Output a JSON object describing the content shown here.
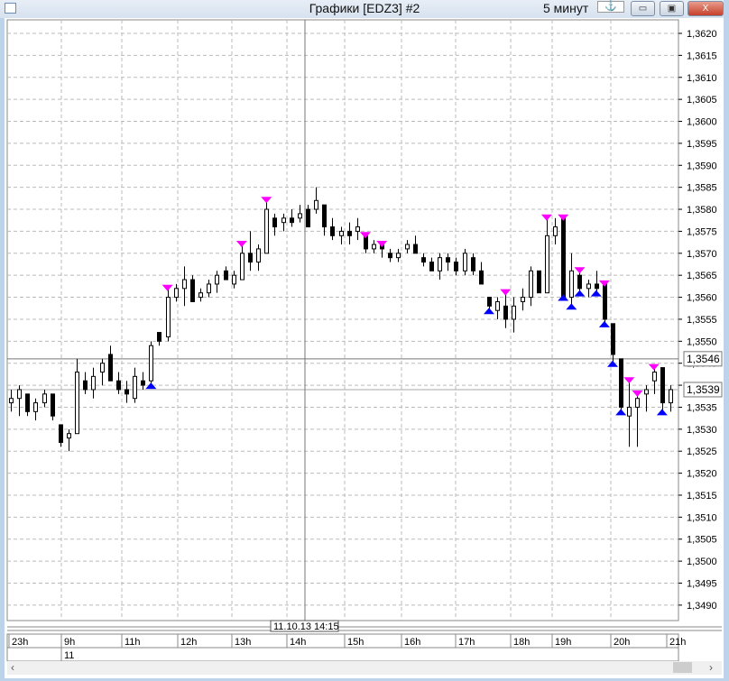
{
  "window": {
    "title": "Графики [EDZ3] #2",
    "timeframe": "5 минут",
    "anchor_icon": "anchor-icon",
    "minimize": "▭",
    "maximize": "▣",
    "close": "X"
  },
  "colors": {
    "sell": "#ff00ff",
    "buy": "#0000ff",
    "up": "#ffffff",
    "down": "#000000",
    "grid": "#bbbbbb"
  },
  "chart_data": {
    "type": "candlestick",
    "title": "Графики [EDZ3] #2",
    "ylim": [
      1.3486,
      1.3625
    ],
    "yticks": [
      "1,3620",
      "1,3615",
      "1,3610",
      "1,3605",
      "1,3600",
      "1,3595",
      "1,3590",
      "1,3585",
      "1,3580",
      "1,3575",
      "1,3570",
      "1,3565",
      "1,3560",
      "1,3555",
      "1,3550",
      "1,3545",
      "1,3540",
      "1,3535",
      "1,3530",
      "1,3525",
      "1,3520",
      "1,3515",
      "1,3510",
      "1,3505",
      "1,3500",
      "1,3495",
      "1,3490"
    ],
    "xticks": [
      "23h",
      "9h",
      "11h",
      "12h",
      "13h",
      "14h",
      "15h",
      "16h",
      "17h",
      "18h",
      "19h",
      "20h",
      "21h"
    ],
    "date_label": "11",
    "crosshair": {
      "time": "11.10.13 14:15",
      "price": "1,3546",
      "price_value": 1.3546
    },
    "last_price": {
      "label": "1,3539",
      "value": 1.3539
    },
    "candles": [
      [
        1.3536,
        1.3539,
        1.3534,
        1.3537
      ],
      [
        1.3537,
        1.354,
        1.3533,
        1.3539
      ],
      [
        1.3538,
        1.3538,
        1.3533,
        1.3534
      ],
      [
        1.3534,
        1.3537,
        1.3532,
        1.3536
      ],
      [
        1.3536,
        1.3539,
        1.3535,
        1.3538
      ],
      [
        1.3538,
        1.3538,
        1.3532,
        1.3533
      ],
      [
        1.3531,
        1.3531,
        1.3526,
        1.3527
      ],
      [
        1.3528,
        1.353,
        1.3525,
        1.3529
      ],
      [
        1.3529,
        1.3546,
        1.3529,
        1.3543
      ],
      [
        1.3541,
        1.3543,
        1.3538,
        1.3539
      ],
      [
        1.3539,
        1.3544,
        1.3537,
        1.3542
      ],
      [
        1.3543,
        1.3546,
        1.354,
        1.3545
      ],
      [
        1.3547,
        1.3549,
        1.3541,
        1.3541
      ],
      [
        1.3541,
        1.3543,
        1.3538,
        1.3539
      ],
      [
        1.3539,
        1.3541,
        1.3536,
        1.3538
      ],
      [
        1.3537,
        1.3544,
        1.3536,
        1.3542
      ],
      [
        1.3541,
        1.3543,
        1.3539,
        1.354
      ],
      [
        1.3541,
        1.355,
        1.354,
        1.3549
      ],
      [
        1.3552,
        1.3552,
        1.3549,
        1.355
      ],
      [
        1.3551,
        1.3562,
        1.355,
        1.356
      ],
      [
        1.356,
        1.3563,
        1.3559,
        1.3562
      ],
      [
        1.3562,
        1.3567,
        1.3558,
        1.3564
      ],
      [
        1.3564,
        1.3565,
        1.3559,
        1.3559
      ],
      [
        1.356,
        1.3562,
        1.3559,
        1.3561
      ],
      [
        1.3561,
        1.3564,
        1.356,
        1.3563
      ],
      [
        1.3563,
        1.3566,
        1.3561,
        1.3565
      ],
      [
        1.3566,
        1.3567,
        1.3564,
        1.3564
      ],
      [
        1.3563,
        1.3566,
        1.3562,
        1.3565
      ],
      [
        1.3564,
        1.3572,
        1.3564,
        1.357
      ],
      [
        1.357,
        1.3575,
        1.3566,
        1.3568
      ],
      [
        1.3568,
        1.3572,
        1.3566,
        1.3571
      ],
      [
        1.357,
        1.3582,
        1.357,
        1.358
      ],
      [
        1.3578,
        1.3579,
        1.3574,
        1.3576
      ],
      [
        1.3577,
        1.3579,
        1.3575,
        1.3578
      ],
      [
        1.3578,
        1.358,
        1.3576,
        1.3577
      ],
      [
        1.3578,
        1.3581,
        1.3577,
        1.3579
      ],
      [
        1.358,
        1.3581,
        1.3576,
        1.3576
      ],
      [
        1.358,
        1.3585,
        1.3579,
        1.3582
      ],
      [
        1.3581,
        1.3581,
        1.3574,
        1.3576
      ],
      [
        1.3576,
        1.3578,
        1.3573,
        1.3574
      ],
      [
        1.3574,
        1.3576,
        1.3572,
        1.3575
      ],
      [
        1.3575,
        1.3577,
        1.3572,
        1.3574
      ],
      [
        1.3575,
        1.3578,
        1.3573,
        1.3576
      ],
      [
        1.3574,
        1.3574,
        1.357,
        1.3571
      ],
      [
        1.3571,
        1.3573,
        1.357,
        1.3572
      ],
      [
        1.3572,
        1.3572,
        1.3569,
        1.3571
      ],
      [
        1.357,
        1.3571,
        1.3568,
        1.3569
      ],
      [
        1.3569,
        1.3571,
        1.3568,
        1.357
      ],
      [
        1.3571,
        1.3573,
        1.357,
        1.3572
      ],
      [
        1.3572,
        1.3574,
        1.357,
        1.357
      ],
      [
        1.3569,
        1.357,
        1.3567,
        1.3568
      ],
      [
        1.3568,
        1.3569,
        1.3566,
        1.3566
      ],
      [
        1.3566,
        1.357,
        1.3564,
        1.3569
      ],
      [
        1.3569,
        1.357,
        1.3566,
        1.3568
      ],
      [
        1.3568,
        1.3569,
        1.3565,
        1.3566
      ],
      [
        1.3566,
        1.3571,
        1.3565,
        1.357
      ],
      [
        1.3569,
        1.357,
        1.3565,
        1.3566
      ],
      [
        1.3566,
        1.3568,
        1.3563,
        1.3563
      ],
      [
        1.356,
        1.356,
        1.3557,
        1.3558
      ],
      [
        1.3557,
        1.356,
        1.3555,
        1.3559
      ],
      [
        1.3558,
        1.3561,
        1.3553,
        1.3555
      ],
      [
        1.3555,
        1.356,
        1.3552,
        1.3558
      ],
      [
        1.3559,
        1.3562,
        1.3557,
        1.356
      ],
      [
        1.356,
        1.3567,
        1.3558,
        1.3566
      ],
      [
        1.3566,
        1.3566,
        1.3561,
        1.3561
      ],
      [
        1.3561,
        1.3578,
        1.3561,
        1.3574
      ],
      [
        1.3574,
        1.3578,
        1.3572,
        1.3576
      ],
      [
        1.3578,
        1.3578,
        1.356,
        1.356
      ],
      [
        1.356,
        1.357,
        1.3558,
        1.3566
      ],
      [
        1.3565,
        1.3566,
        1.3561,
        1.3562
      ],
      [
        1.3562,
        1.3564,
        1.356,
        1.3563
      ],
      [
        1.3563,
        1.3566,
        1.3561,
        1.3562
      ],
      [
        1.3563,
        1.3563,
        1.3554,
        1.3555
      ],
      [
        1.3554,
        1.3554,
        1.3545,
        1.3547
      ],
      [
        1.3546,
        1.3546,
        1.3534,
        1.3535
      ],
      [
        1.3533,
        1.3541,
        1.3526,
        1.3535
      ],
      [
        1.3535,
        1.3538,
        1.3526,
        1.3537
      ],
      [
        1.3538,
        1.354,
        1.3534,
        1.3539
      ],
      [
        1.3541,
        1.3544,
        1.3538,
        1.3543
      ],
      [
        1.3544,
        1.3544,
        1.3534,
        1.3536
      ],
      [
        1.3536,
        1.354,
        1.3534,
        1.3539
      ]
    ],
    "signals": {
      "sell": [
        19,
        28,
        31,
        43,
        45,
        60,
        65,
        67,
        69,
        72,
        75,
        76,
        78
      ],
      "buy": [
        17,
        58,
        67,
        68,
        69,
        71,
        72,
        73,
        74,
        79
      ]
    }
  }
}
